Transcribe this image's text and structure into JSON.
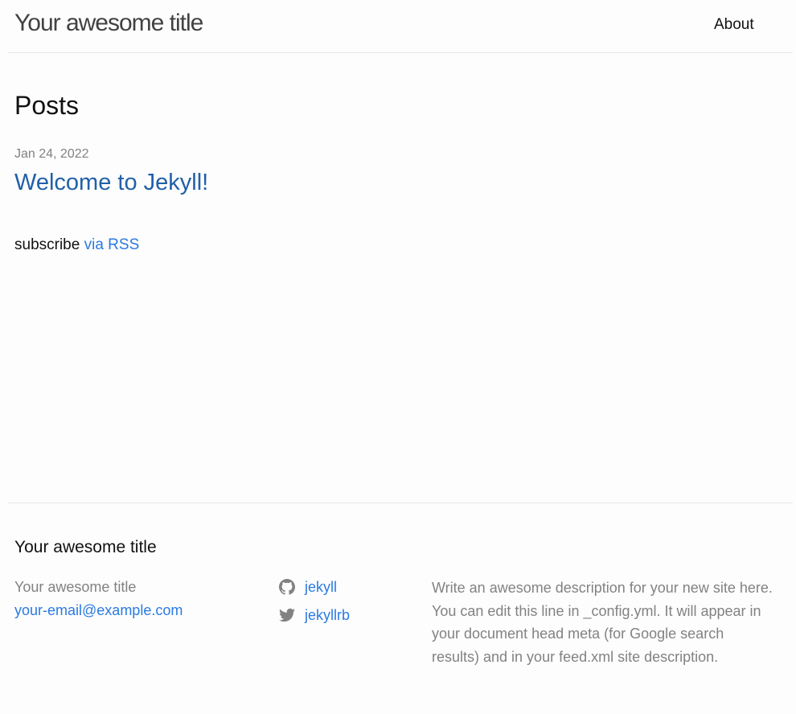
{
  "header": {
    "site_title": "Your awesome title",
    "nav": [
      {
        "label": "About"
      }
    ]
  },
  "main": {
    "page_heading": "Posts",
    "posts": [
      {
        "date": "Jan 24, 2022",
        "title": "Welcome to Jekyll!"
      }
    ],
    "rss": {
      "prefix": "subscribe",
      "link_label": "via RSS"
    }
  },
  "footer": {
    "heading": "Your awesome title",
    "name": "Your awesome title",
    "email": "your-email@example.com",
    "social": [
      {
        "icon": "github-icon",
        "label": "jekyll"
      },
      {
        "icon": "twitter-icon",
        "label": "jekyllrb"
      }
    ],
    "description": "Write an awesome description for your new site here. You can edit this line in _config.yml. It will appear in your document head meta (for Google search results) and in your feed.xml site description."
  },
  "colors": {
    "link": "#2a7ae2",
    "muted": "#828282",
    "text": "#111111",
    "background": "#fdfdfd",
    "rule": "#e8e8e8"
  }
}
